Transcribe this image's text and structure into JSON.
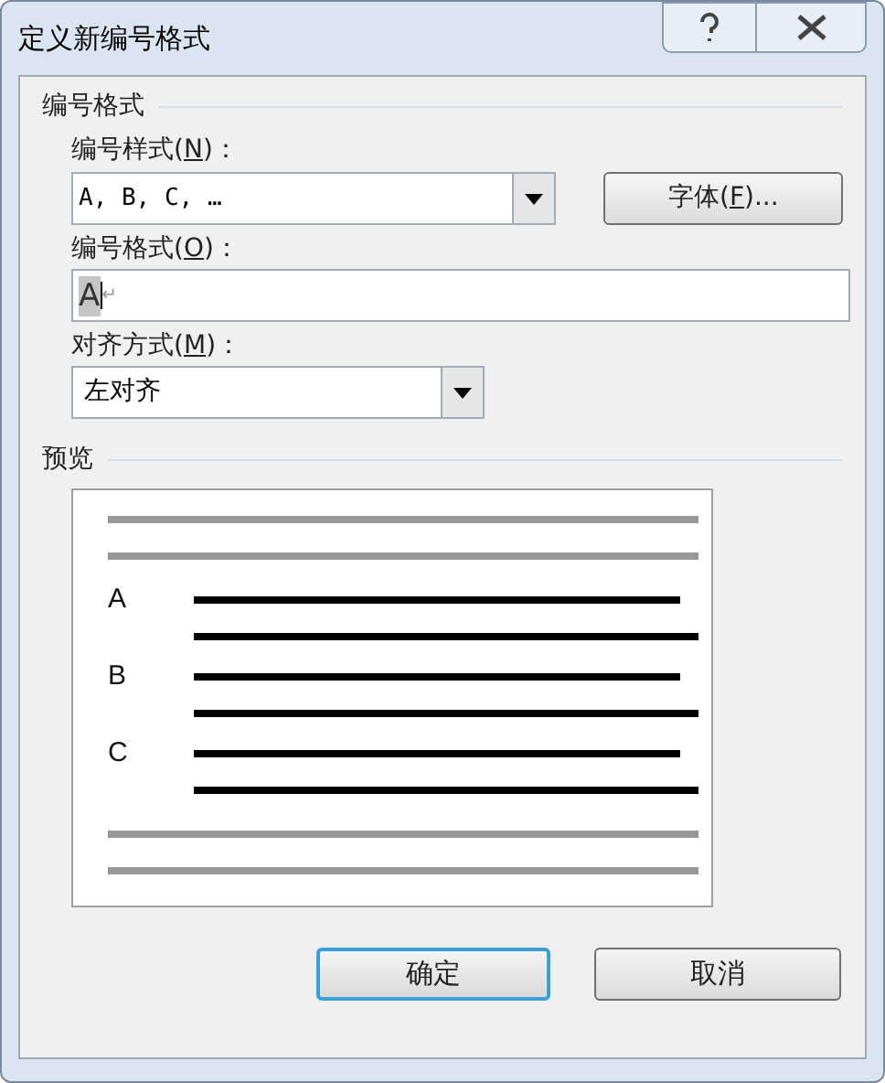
{
  "window": {
    "title": "定义新编号格式"
  },
  "number_format_group": {
    "title": "编号格式",
    "number_style": {
      "label": "编号样式(",
      "accesskey": "N",
      "label_end": ")：",
      "value": "A, B, C, …"
    },
    "font_button": {
      "label": "字体(",
      "accesskey": "F",
      "label_end": ")..."
    },
    "number_format": {
      "label": "编号格式(",
      "accesskey": "O",
      "label_end": ")：",
      "value": "A",
      "value_selected": true,
      "paragraph_mark": "↵"
    },
    "alignment": {
      "label": "对齐方式(",
      "accesskey": "M",
      "label_end": ")：",
      "value": "左对齐"
    }
  },
  "preview": {
    "title": "预览",
    "items": [
      "A",
      "B",
      "C"
    ]
  },
  "buttons": [
    {
      "label": "确定",
      "default": true
    },
    {
      "label": "取消",
      "default": false
    }
  ]
}
